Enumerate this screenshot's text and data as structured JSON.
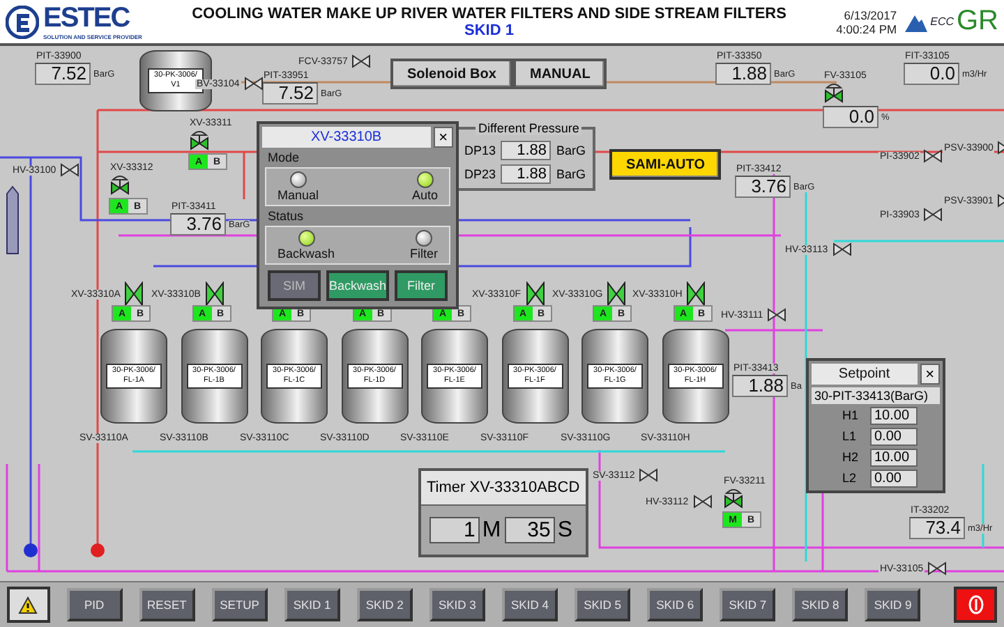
{
  "header": {
    "logo": "ESTEC",
    "tagline": "SOLUTION AND SERVICE PROVIDER",
    "title": "COOLING WATER MAKE UP RIVER WATER FILTERS AND SIDE STREAM FILTERS",
    "subtitle": "SKID 1",
    "date": "6/13/2017",
    "time": "4:00:24 PM",
    "partner_logo": "ECC",
    "partner_mark": "GR"
  },
  "vessel": {
    "label": "30-PK-3006/ V1"
  },
  "instruments": [
    {
      "kind": "meter",
      "tag": "PIT-33900",
      "value": "7.52",
      "unit": "BarG"
    },
    {
      "kind": "meter",
      "tag": "PIT-33951",
      "value": "7.52",
      "unit": "BarG"
    },
    {
      "kind": "meter",
      "tag": "PIT-33350",
      "value": "1.88",
      "unit": "BarG"
    },
    {
      "kind": "meter",
      "tag": "FIT-33105",
      "value": "0.0",
      "unit": "m3/Hr"
    },
    {
      "kind": "meter",
      "tag": "PIT-33412",
      "value": "3.76",
      "unit": "BarG"
    },
    {
      "kind": "meter",
      "tag": "PIT-33411",
      "value": "3.76",
      "unit": "BarG"
    },
    {
      "kind": "meter",
      "tag": "PIT-33413",
      "value": "1.88",
      "unit": "Ba"
    },
    {
      "kind": "meter",
      "tag": "IT-33202",
      "value": "73.4",
      "unit": "m3/Hr"
    },
    {
      "kind": "valve",
      "tag": "FV-33105",
      "value": "0.0",
      "unit": "%"
    }
  ],
  "tags": [
    {
      "text": "BV-33104"
    },
    {
      "text": "FCV-33757"
    },
    {
      "text": "HV-33100"
    },
    {
      "text": "PI-33902"
    },
    {
      "text": "PSV-33900"
    },
    {
      "text": "PSV-33901"
    },
    {
      "text": "PI-33903"
    },
    {
      "text": "HV-33113"
    },
    {
      "text": "HV-33111"
    },
    {
      "text": "SV-33112"
    },
    {
      "text": "HV-33112"
    },
    {
      "text": "HV-33105"
    }
  ],
  "control_valves": [
    {
      "tag": "XV-33311",
      "modes": [
        {
          "label": "A",
          "selected": true
        },
        {
          "label": "B",
          "selected": false
        }
      ]
    },
    {
      "tag": "XV-33312",
      "modes": [
        {
          "label": "A",
          "selected": true
        },
        {
          "label": "B",
          "selected": false
        }
      ]
    },
    {
      "tag": "FV-33211",
      "modes": [
        {
          "label": "M",
          "selected": true
        },
        {
          "label": "B",
          "selected": false
        }
      ]
    }
  ],
  "filters": [
    {
      "valve_tag": "XV-33310A",
      "tank": "30-PK-3006/ FL-1A",
      "drain": "SV-33110A",
      "modes": [
        {
          "label": "A",
          "selected": true
        },
        {
          "label": "B",
          "selected": false
        }
      ]
    },
    {
      "valve_tag": "XV-33310B",
      "tank": "30-PK-3006/ FL-1B",
      "drain": "SV-33110B",
      "modes": [
        {
          "label": "A",
          "selected": true
        },
        {
          "label": "B",
          "selected": false
        }
      ]
    },
    {
      "tank": "30-PK-3006/ FL-1C",
      "drain": "SV-33110C",
      "modes": [
        {
          "label": "A",
          "selected": true
        },
        {
          "label": "B",
          "selected": false
        }
      ]
    },
    {
      "tank": "30-PK-3006/ FL-1D",
      "drain": "SV-33110D",
      "modes": [
        {
          "label": "A",
          "selected": true
        },
        {
          "label": "B",
          "selected": false
        }
      ]
    },
    {
      "tank": "30-PK-3006/ FL-1E",
      "drain": "SV-33110E",
      "modes": [
        {
          "label": "A",
          "selected": true
        },
        {
          "label": "B",
          "selected": false
        }
      ]
    },
    {
      "valve_tag": "XV-33310F",
      "tank": "30-PK-3006/ FL-1F",
      "drain": "SV-33110F",
      "modes": [
        {
          "label": "A",
          "selected": true
        },
        {
          "label": "B",
          "selected": false
        }
      ]
    },
    {
      "valve_tag": "XV-33310G",
      "tank": "30-PK-3006/ FL-1G",
      "drain": "SV-33110G",
      "modes": [
        {
          "label": "A",
          "selected": true
        },
        {
          "label": "B",
          "selected": false
        }
      ]
    },
    {
      "valve_tag": "XV-33310H",
      "tank": "30-PK-3006/ FL-1H",
      "drain": "SV-33110H",
      "modes": [
        {
          "label": "A",
          "selected": true
        },
        {
          "label": "B",
          "selected": false
        }
      ]
    }
  ],
  "buttons": [
    {
      "label": "Solenoid Box",
      "kind": "plain"
    },
    {
      "label": "MANUAL",
      "kind": "plain"
    },
    {
      "label": "SAMI-AUTO",
      "kind": "alert"
    }
  ],
  "valve_popup": {
    "title": "XV-33310B",
    "close": "×",
    "mode_title": "Mode",
    "modes": [
      {
        "label": "Manual",
        "selected": false
      },
      {
        "label": "Auto",
        "selected": true
      }
    ],
    "status_title": "Status",
    "statuses": [
      {
        "label": "Backwash",
        "selected": true
      },
      {
        "label": "Filter",
        "selected": false
      }
    ],
    "actions": [
      {
        "label": "SIM",
        "disabled": true
      },
      {
        "label": "Backwash",
        "disabled": false
      },
      {
        "label": "Filter",
        "disabled": false
      }
    ]
  },
  "diff_pressure": {
    "title": "Different Pressure",
    "rows": [
      {
        "label": "DP13",
        "value": "1.88",
        "unit": "BarG"
      },
      {
        "label": "DP23",
        "value": "1.88",
        "unit": "BarG"
      }
    ]
  },
  "timer": {
    "title": "Timer XV-33310ABCD",
    "minutes": "1",
    "minutes_unit": "M",
    "seconds": "35",
    "seconds_unit": "S"
  },
  "setpoint": {
    "title": "Setpoint",
    "close": "×",
    "subtitle": "30-PIT-33413(BarG)",
    "rows": [
      {
        "label": "H1",
        "value": "10.00"
      },
      {
        "label": "L1",
        "value": "0.00"
      },
      {
        "label": "H2",
        "value": "10.00"
      },
      {
        "label": "L2",
        "value": "0.00"
      }
    ]
  },
  "nav": [
    "PID",
    "RESET",
    "SETUP",
    "SKID 1",
    "SKID 2",
    "SKID 3",
    "SKID 4",
    "SKID 5",
    "SKID 6",
    "SKID 7",
    "SKID 8",
    "SKID 9"
  ]
}
